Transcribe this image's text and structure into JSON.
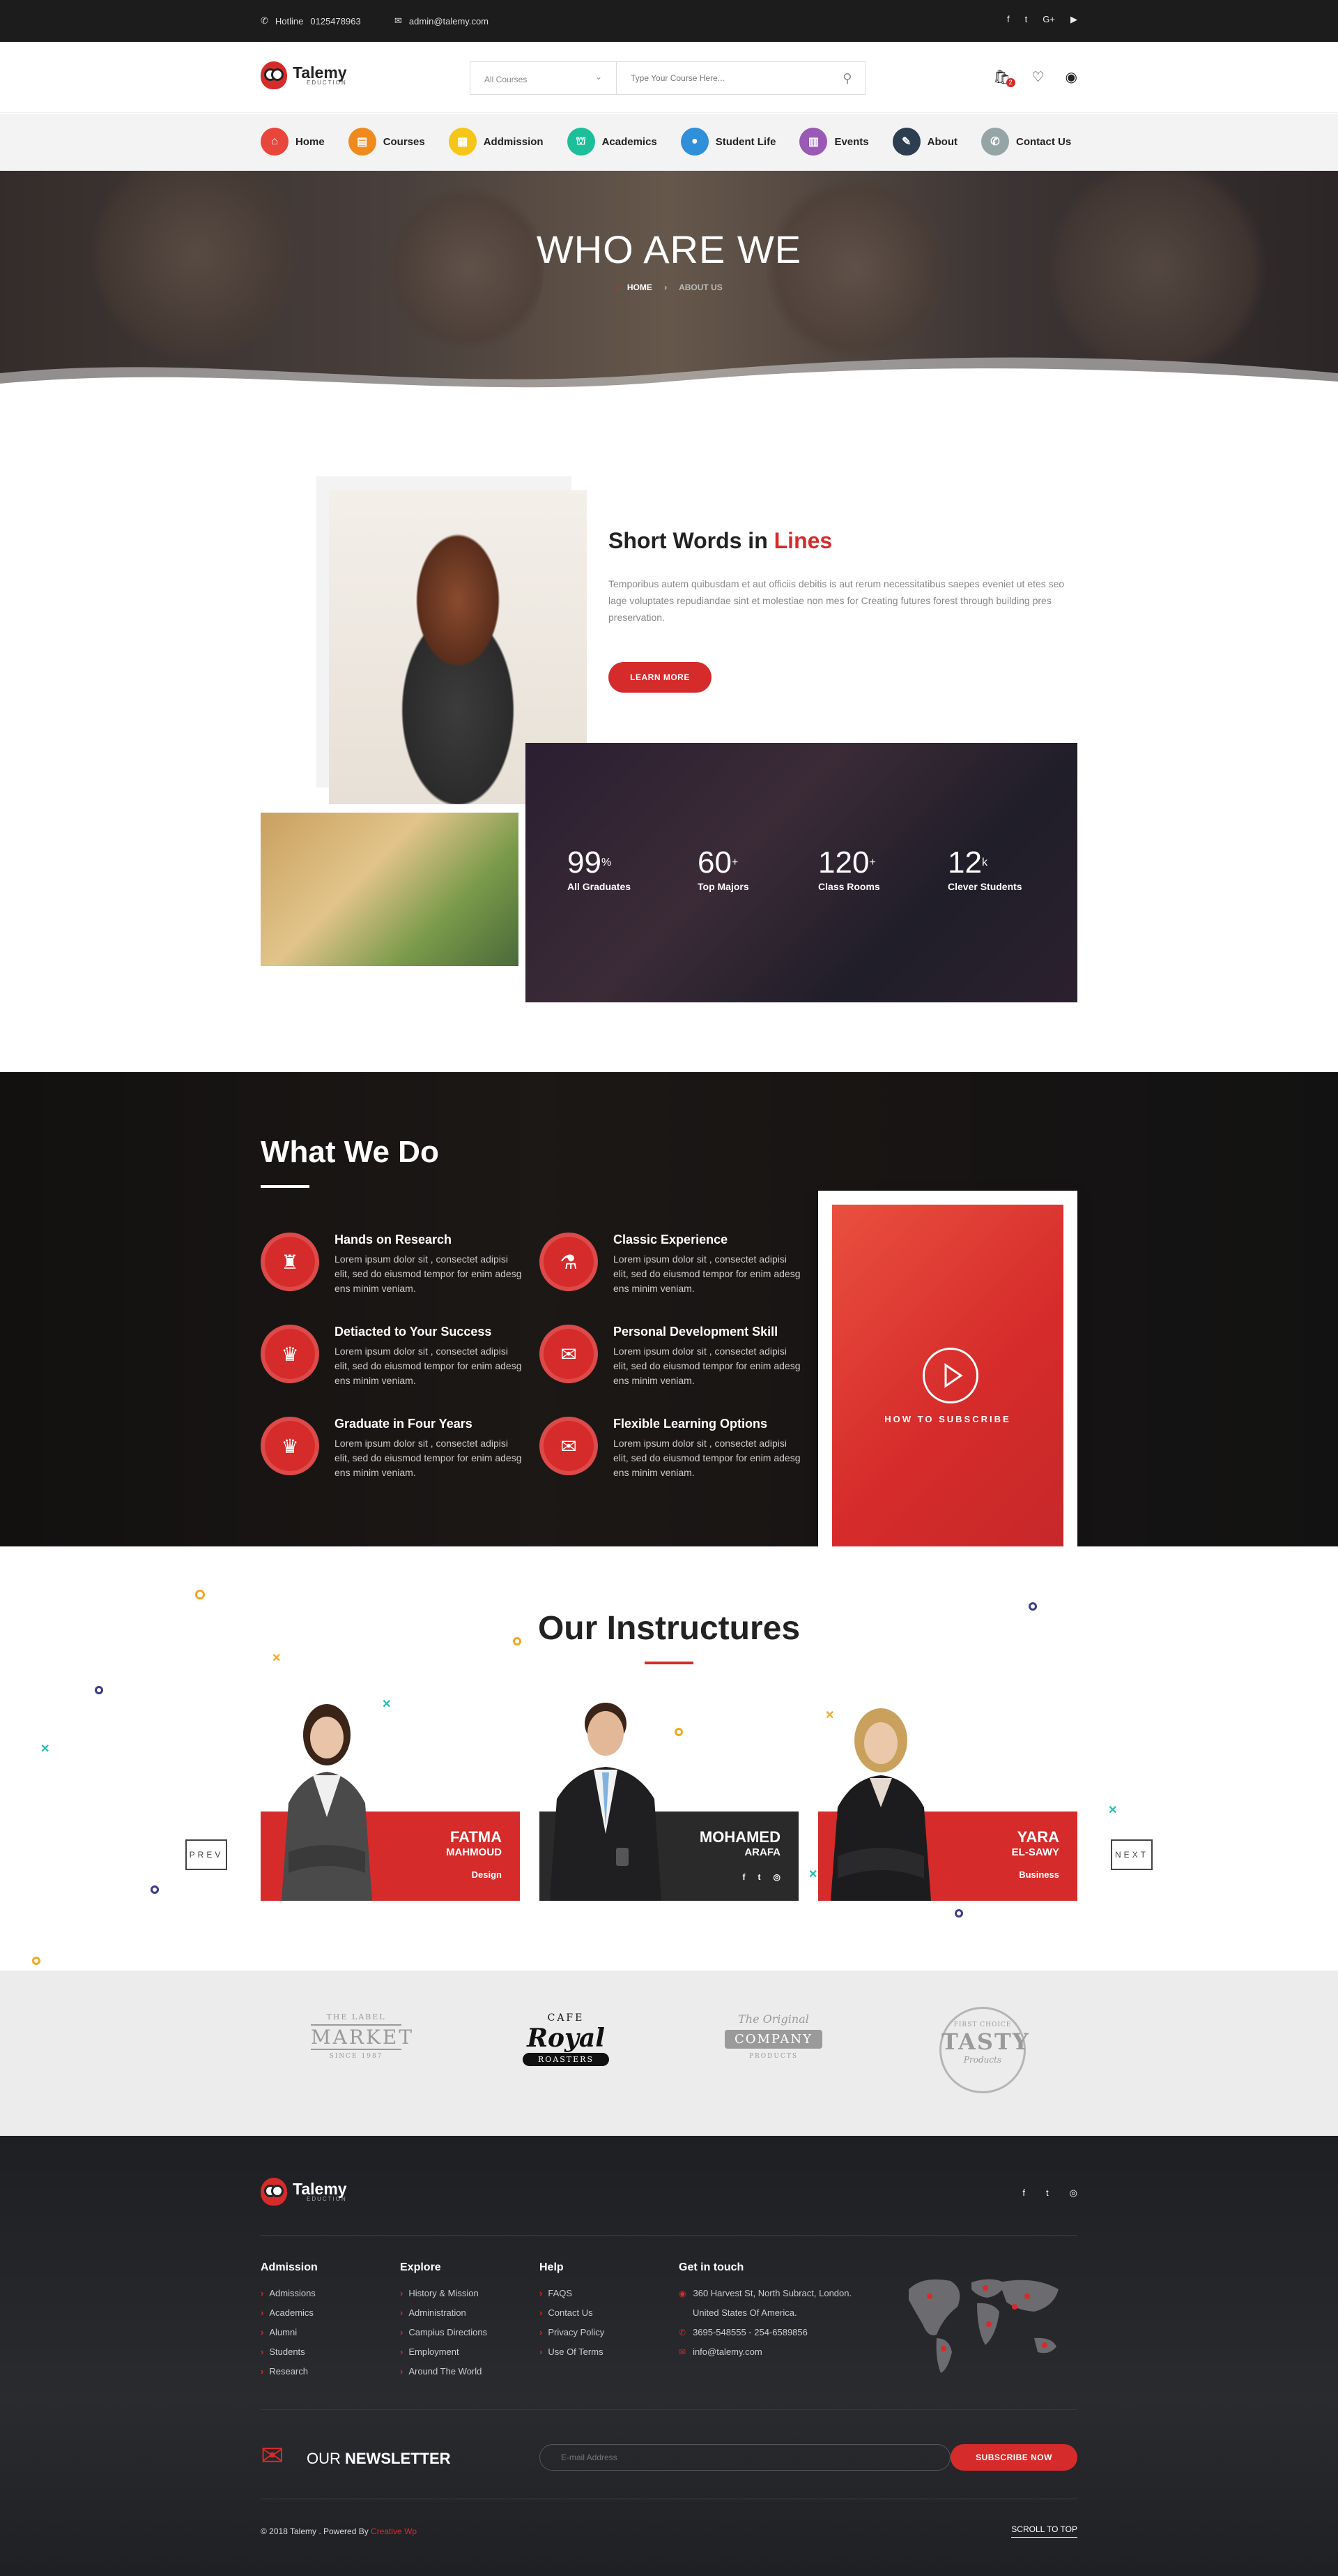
{
  "topbar": {
    "hotline_label": "Hotline",
    "hotline_number": "0125478963",
    "email": "admin@talemy.com",
    "social": [
      "f",
      "t",
      "G+",
      "▶"
    ]
  },
  "brand": {
    "name": "Talemy",
    "tagline": "EDUCTION"
  },
  "search": {
    "category": "All Courses",
    "placeholder": "Type Your Course Here..."
  },
  "cart": {
    "count": "2"
  },
  "nav": {
    "items": [
      {
        "label": "Home",
        "color": "#e8463b",
        "icon": "home-icon"
      },
      {
        "label": "Courses",
        "color": "#f08a1d",
        "icon": "book-icon"
      },
      {
        "label": "Addmission",
        "color": "#f5c518",
        "icon": "form-icon"
      },
      {
        "label": "Academics",
        "color": "#1dbf9a",
        "icon": "graduation-cap-icon"
      },
      {
        "label": "Student Life",
        "color": "#2f8fd8",
        "icon": "user-icon"
      },
      {
        "label": "Events",
        "color": "#9b59b6",
        "icon": "calendar-icon"
      },
      {
        "label": "About",
        "color": "#2c3e50",
        "icon": "compass-icon"
      },
      {
        "label": "Contact Us",
        "color": "#95a5a6",
        "icon": "phone-icon"
      }
    ]
  },
  "hero": {
    "title": "WHO ARE WE",
    "crumb_home": "HOME",
    "crumb_current": "ABOUT US"
  },
  "about": {
    "title_main": "Short Words in ",
    "title_accent": "Lines",
    "text": "Temporibus autem quibusdam et aut officiis debitis is aut rerum necessitatibus saepes eveniet ut etes seo lage voluptates repudiandae sint et molestiae non mes  for Creating  futures forest through building pres preservation.",
    "button": "LEARN MORE",
    "stats": [
      {
        "value": "99",
        "unit": "%",
        "label": "All Graduates"
      },
      {
        "value": "60",
        "unit": "+",
        "label": "Top Majors"
      },
      {
        "value": "120",
        "unit": "+",
        "label": "Class Rooms"
      },
      {
        "value": "12",
        "unit": "k",
        "label": "Clever Students"
      }
    ]
  },
  "what_we_do": {
    "title": "What We Do",
    "features": [
      {
        "title": "Hands on Research",
        "text": "Lorem ipsum dolor sit , consectet adipisi elit, sed do eiusmod tempor for enim adesg ens minim veniam.",
        "icon": "backpack-icon"
      },
      {
        "title": "Classic Experience",
        "text": "Lorem ipsum dolor sit , consectet adipisi elit, sed do eiusmod tempor for enim adesg ens minim veniam.",
        "icon": "flask-icon"
      },
      {
        "title": "Detiacted to Your Success",
        "text": "Lorem ipsum dolor sit , consectet adipisi elit, sed do eiusmod tempor for enim adesg ens minim veniam.",
        "icon": "trophy-icon"
      },
      {
        "title": "Personal Development Skill",
        "text": "Lorem ipsum dolor sit , consectet adipisi elit, sed do eiusmod tempor for enim adesg ens minim veniam.",
        "icon": "scroll-icon"
      },
      {
        "title": "Graduate in Four Years",
        "text": "Lorem ipsum dolor sit , consectet adipisi elit, sed do eiusmod tempor for enim adesg ens minim veniam.",
        "icon": "trophy-icon"
      },
      {
        "title": "Flexible Learning Options",
        "text": "Lorem ipsum dolor sit , consectet adipisi elit, sed do eiusmod tempor for enim adesg ens minim veniam.",
        "icon": "scroll-icon"
      }
    ],
    "video_label": "HOW TO SUBSCRIBE"
  },
  "instructors": {
    "title": "Our Instructures",
    "prev": "PREV",
    "next": "NEXT",
    "people": [
      {
        "first": "FATMA",
        "last": "MAHMOUD",
        "role": "Design"
      },
      {
        "first": "MOHAMED",
        "last": "ARAFA",
        "role": ""
      },
      {
        "first": "YARA",
        "last": "EL-SAWY",
        "role": "Business"
      }
    ]
  },
  "partners": [
    {
      "top": "THE LABEL",
      "main": "MARKET",
      "bottom": "SINCE 1987"
    },
    {
      "top": "CAFE",
      "main": "Royal",
      "bottom": "ROASTERS"
    },
    {
      "top": "The Original",
      "main": "COMPANY",
      "bottom": "PRODUCTS"
    },
    {
      "top": "FIRST CHOICE",
      "main": "TASTY",
      "bottom": "Products"
    }
  ],
  "footer": {
    "columns": [
      {
        "title": "Admission",
        "links": [
          "Admissions",
          "Academics",
          "Alumni",
          "Students",
          "Research"
        ]
      },
      {
        "title": "Explore",
        "links": [
          "History & Mission",
          "Administration",
          "Campius Directions",
          "Employment",
          "Around The World"
        ]
      },
      {
        "title": "Help",
        "links": [
          "FAQS",
          "Contact Us",
          "Privacy Policy",
          "Use Of Terms"
        ]
      }
    ],
    "contact_title": "Get in touch",
    "address1": "360 Harvest St, North Subract, London.",
    "address2": "United States Of America.",
    "phone": "3695-548555  -  254-6589856",
    "email": "info@talemy.com",
    "newsletter_prefix": "OUR ",
    "newsletter_bold": "NEWSLETTER",
    "newsletter_placeholder": "E-mail Address",
    "subscribe": "SUBSCRIBE NOW",
    "copyright": "© 2018 Talemy . Powered By ",
    "powered_by": "Creative Wp",
    "scroll_top": "SCROLL TO TOP"
  }
}
